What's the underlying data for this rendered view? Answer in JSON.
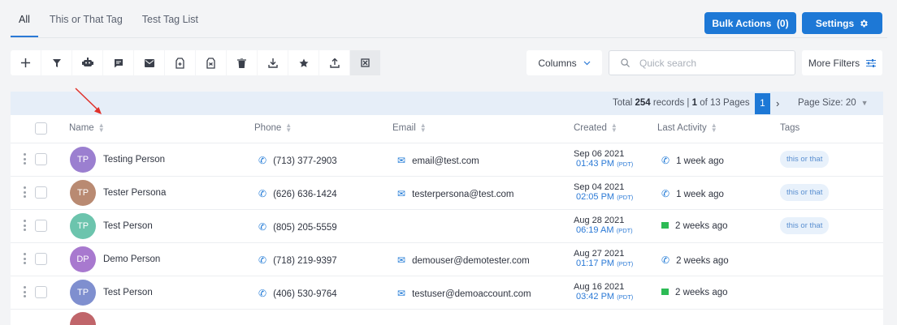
{
  "tabs": [
    "All",
    "This or That Tag",
    "Test Tag List"
  ],
  "header_buttons": {
    "bulk_actions": "Bulk Actions  (0)",
    "settings": "Settings"
  },
  "toolbar": {
    "icons": [
      "add-icon",
      "filter-icon",
      "robot-icon",
      "message-icon",
      "mail-icon",
      "tag-add-icon",
      "tag-remove-icon",
      "trash-icon",
      "download-icon",
      "star-icon",
      "upload-icon",
      "merge-icon"
    ],
    "columns_label": "Columns",
    "search_placeholder": "Quick search",
    "more_filters": "More Filters"
  },
  "pagination": {
    "total_prefix": "Total",
    "total_records": "254",
    "records_suffix": "records |",
    "current_page": "1",
    "of_pages": "of 13 Pages",
    "page_size": "Page Size: 20"
  },
  "columns": [
    "Name",
    "Phone",
    "Email",
    "Created",
    "Last Activity",
    "Tags"
  ],
  "rows": [
    {
      "initials": "TP",
      "avatar_color": "#9b7fd0",
      "name": "Testing Person",
      "phone": "(713) 377-2903",
      "email": "email@test.com",
      "created_date": "Sep 06 2021",
      "created_time": "01:43 PM",
      "tz": "(PDT)",
      "activity_icon": "phone-icon",
      "activity": "1 week ago",
      "tag": "this or that"
    },
    {
      "initials": "TP",
      "avatar_color": "#b98a72",
      "name": "Tester Persona",
      "phone": "(626) 636-1424",
      "email": "testerpersona@test.com",
      "created_date": "Sep 04 2021",
      "created_time": "02:05 PM",
      "tz": "(PDT)",
      "activity_icon": "phone-icon",
      "activity": "1 week ago",
      "tag": "this or that"
    },
    {
      "initials": "TP",
      "avatar_color": "#6cc4ad",
      "name": "Test Person",
      "phone": "(805) 205-5559",
      "email": "",
      "created_date": "Aug 28 2021",
      "created_time": "06:19 AM",
      "tz": "(PDT)",
      "activity_icon": "flag-icon",
      "activity": "2 weeks ago",
      "tag": "this or that"
    },
    {
      "initials": "DP",
      "avatar_color": "#a879cf",
      "name": "Demo Person",
      "phone": "(718) 219-9397",
      "email": "demouser@demotester.com",
      "created_date": "Aug 27 2021",
      "created_time": "01:17 PM",
      "tz": "(PDT)",
      "activity_icon": "phone-icon",
      "activity": "2 weeks ago",
      "tag": ""
    },
    {
      "initials": "TP",
      "avatar_color": "#7f8fcf",
      "name": "Test Person",
      "phone": "(406) 530-9764",
      "email": "testuser@demoaccount.com",
      "created_date": "Aug 16 2021",
      "created_time": "03:42 PM",
      "tz": "(PDT)",
      "activity_icon": "flag-icon",
      "activity": "2 weeks ago",
      "tag": ""
    }
  ],
  "colors": {
    "accent": "#1d78d6",
    "annotation_arrow": "#e0322b"
  }
}
